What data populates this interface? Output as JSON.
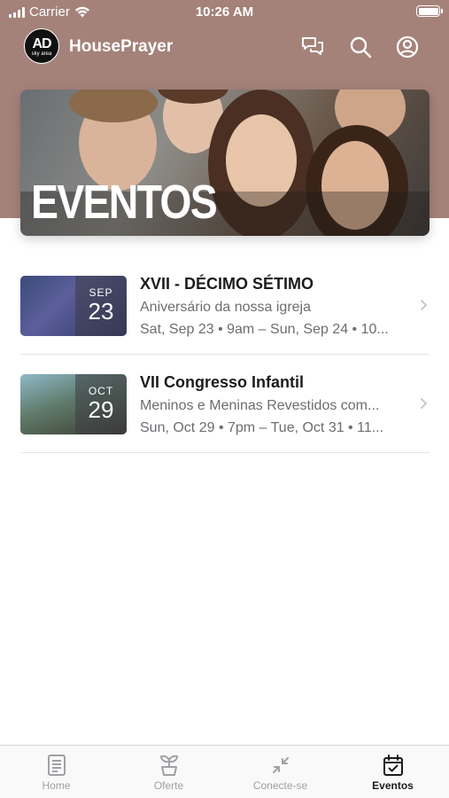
{
  "status_bar": {
    "carrier": "Carrier",
    "time": "10:26 AM"
  },
  "header": {
    "logo_text": "AD",
    "logo_subtext": "sky area",
    "app_name": "HousePrayer",
    "icons": [
      "chat-icon",
      "search-icon",
      "profile-icon"
    ]
  },
  "banner": {
    "title": "EVENTOS"
  },
  "events": [
    {
      "title": "XVII - DÉCIMO SÉTIMO",
      "subtitle": "Aniversário da nossa igreja",
      "meta": "Sat, Sep 23 • 9am – Sun, Sep 24 • 10...",
      "month": "SEP",
      "day": "23"
    },
    {
      "title": "VII Congresso Infantil",
      "subtitle": "Meninos e Meninas Revestidos com...",
      "meta": "Sun, Oct 29 • 7pm – Tue, Oct 31 • 11...",
      "month": "OCT",
      "day": "29"
    }
  ],
  "tabs": [
    {
      "label": "Home",
      "icon": "document-icon",
      "active": false
    },
    {
      "label": "Oferte",
      "icon": "plant-icon",
      "active": false
    },
    {
      "label": "Conecte-se",
      "icon": "arrows-in-icon",
      "active": false
    },
    {
      "label": "Eventos",
      "icon": "calendar-check-icon",
      "active": true
    }
  ],
  "colors": {
    "header_bg": "#a4827a",
    "text_primary": "#1c1c1e",
    "text_secondary": "#6d6d72",
    "tab_inactive": "#a0a0a5"
  }
}
